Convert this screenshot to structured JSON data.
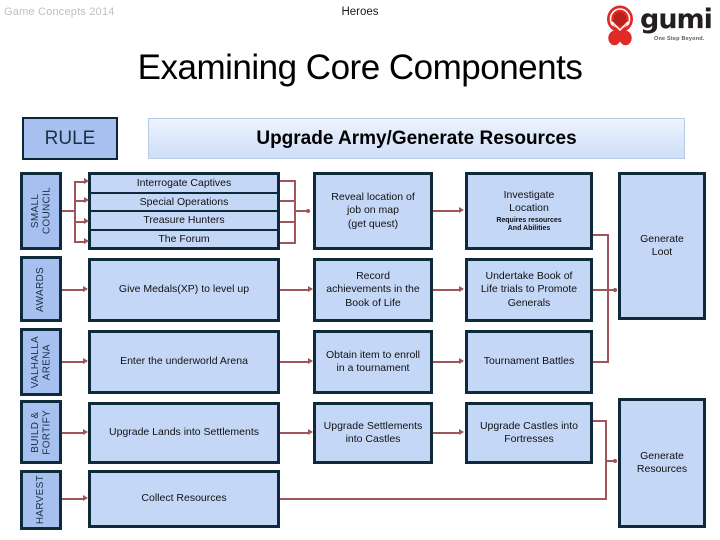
{
  "header": {
    "left_label": "Game Concepts 2014",
    "center_label": "Heroes",
    "logo_word": "gumi",
    "logo_tagline": "One Step Beyond.",
    "logo_icon": "gumi-droplet-logo"
  },
  "title": "Examining Core Components",
  "rule": {
    "label": "RULE"
  },
  "banner": {
    "label": "Upgrade Army/Generate Resources"
  },
  "colors": {
    "box_fill": "#c4d7f7",
    "category_fill": "#a8c0f0",
    "border": "#0d2b3b",
    "connector": "#a0555a",
    "banner_top": "#eef4fd",
    "banner_bottom": "#cfdff8"
  },
  "categories": [
    {
      "label": "SMALL\nCOUNCIL"
    },
    {
      "label": "AWARDS"
    },
    {
      "label": "VALHALLA\nARENA"
    },
    {
      "label": "BUILD &\nFORTIFY"
    },
    {
      "label": "HARVEST"
    }
  ],
  "rows": [
    {
      "category": "SMALL COUNCIL",
      "stack_items": [
        "Interrogate Captives",
        "Special Operations",
        "Treasure Hunters",
        "The Forum"
      ],
      "col3": {
        "label": "Reveal location of\njob on map\n(get quest)"
      },
      "col4": {
        "label": "Investigate\nLocation",
        "sub": "Requires resources\nAnd Abilities"
      }
    },
    {
      "category": "AWARDS",
      "col2": {
        "label": "Give Medals(XP) to level up"
      },
      "col3": {
        "label": "Record\nachievements in the\nBook of Life"
      },
      "col4": {
        "label": "Undertake Book of\nLife trials to Promote\nGenerals"
      }
    },
    {
      "category": "VALHALLA ARENA",
      "col2": {
        "label": "Enter the underworld Arena"
      },
      "col3": {
        "label": "Obtain item to enroll\nin a tournament"
      },
      "col4": {
        "label": "Tournament Battles"
      }
    },
    {
      "category": "BUILD & FORTIFY",
      "col2": {
        "label": "Upgrade Lands into Settlements"
      },
      "col3": {
        "label": "Upgrade Settlements\ninto Castles"
      },
      "col4": {
        "label": "Upgrade Castles into\nFortresses"
      }
    },
    {
      "category": "HARVEST",
      "col2": {
        "label": "Collect Resources"
      }
    }
  ],
  "outputs": [
    {
      "label": "Generate\nLoot"
    },
    {
      "label": "Generate\nResources"
    }
  ]
}
